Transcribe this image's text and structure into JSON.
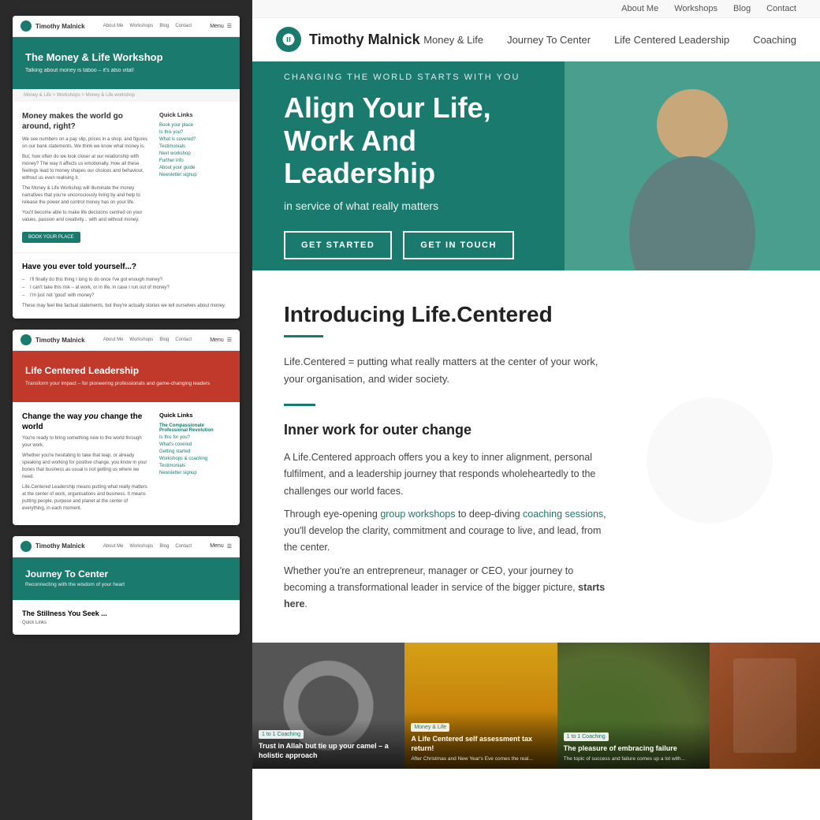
{
  "site": {
    "logo_text": "Timothy Malnick",
    "top_nav": {
      "about_me": "About Me",
      "workshops": "Workshops",
      "blog": "Blog",
      "contact": "Contact"
    },
    "main_nav": {
      "money_life": "Money & Life",
      "journey_to_center": "Journey To Center",
      "life_centered_leadership": "Life Centered Leadership",
      "coaching": "Coaching"
    },
    "hero": {
      "subtitle": "Changing the world starts with you",
      "title_line1": "Align Your Life,",
      "title_line2": "Work And Leadership",
      "tagline": "in service of what really matters",
      "btn_started": "GET STARTED",
      "btn_touch": "GET IN TOUCH"
    },
    "intro": {
      "heading": "Introducing Life.Centered",
      "body": "Life.Centered = putting what really matters at the center of your work, your organisation, and wider society.",
      "inner_work_heading": "Inner work for outer change",
      "para1": "A Life.Centered approach offers you a key to inner alignment, personal fulfilment, and a leadership journey that responds wholeheartedly to the challenges our world faces.",
      "para2_prefix": "Through eye-opening ",
      "para2_workshops": "group workshops",
      "para2_mid": " to deep-diving ",
      "para2_coaching": "coaching sessions",
      "para2_suffix": ", you'll develop the clarity, commitment and courage to live, and lead, from the center.",
      "para3_prefix": "Whether you're an entrepreneur, manager or CEO, your journey to becoming a transformational leader in service of the bigger picture, ",
      "para3_bold": "starts here",
      "para3_suffix": "."
    }
  },
  "preview_cards": {
    "card1": {
      "menu_label": "Menu",
      "logo_text": "Timothy Malnick",
      "nav_links": [
        "About Me",
        "Workshops",
        "Blog",
        "Contact"
      ],
      "hero_title": "The Money & Life Workshop",
      "hero_subtitle": "Talking about money is taboo – it's also vital!",
      "breadcrumb": "Money & Life > Workshops > Money & Life workshop",
      "main_heading": "Money makes the world go around, right?",
      "main_body_1": "We see numbers on a pay slip, prices in a shop, and figures on our bank statements. We think we know what money is.",
      "main_body_2": "But, how often do we look closer at our relationship with money? The way it affects us emotionally. How all these feelings lead to money shapes our choices and behaviour, without us even realising it.",
      "main_body_3": "The Money & Life Workshop will illuminate the money narratives that you're unconsciously living by and help to release the power and control money has on your life.",
      "main_body_4": "You'll become able to make life decisions centred on your values, passion and creativity... with and without money.",
      "book_btn": "BOOK YOUR PLACE",
      "quick_links_title": "Quick Links",
      "quick_links": [
        "Book your place",
        "Is this you?",
        "What is covered?",
        "Testimonials",
        "Next workshop",
        "Further info",
        "About your guide",
        "Newsletter signup"
      ],
      "have_you_heading": "Have you ever told yourself...?",
      "have_you_items": [
        "I'll finally do this thing I long to do once I've got enough money?",
        "I can't take this risk – at work, or in life, in case I run out of money?",
        "I'm just not 'good' with money?"
      ],
      "have_you_footer": "These may feel like factual statements, but they're actually stories we tell ourselves about money."
    },
    "card2": {
      "logo_text": "Timothy Malnick",
      "menu_label": "Menu",
      "hero_title": "Life Centered Leadership",
      "hero_subtitle": "Transform your impact – for pioneering professionals and game-changing leaders",
      "main_heading": "Change the way you change the world",
      "main_body_1": "You're ready to bring something new to the world through your work.",
      "main_body_2": "Whether you're hesitating to take that leap, or already speaking and working for positive change, you know in your bones that business as usual is not getting us where we need.",
      "main_body_3": "Life.Centered Leadership means putting what really matters at the center of work, organisations and business. It means putting people, purpose and planet at the center of everything, in each moment.",
      "quick_links_title": "Quick Links",
      "quick_links": [
        "The Compassionate Professional Revolution",
        "Is this for you?",
        "What's covered",
        "Getting started",
        "Workshops & coaching",
        "Testimonials",
        "Newsletter signup"
      ]
    },
    "card3": {
      "logo_text": "Timothy Malnick",
      "menu_label": "Menu",
      "hero_title": "Journey To Center",
      "hero_subtitle": "Reconnecting with the wisdom of your heart",
      "teaser_heading": "The Stillness You Seek ...",
      "teaser_body": "Quick Links"
    }
  },
  "blog_cards": [
    {
      "tag": "1 to 1 Coaching",
      "title": "Trust in Allah but tie up your camel – a holistic approach",
      "excerpt": ""
    },
    {
      "tag": "Money & Life",
      "title": "A Life Centered self assessment tax return!",
      "excerpt": "After Christmas and New Year's Eve comes the real..."
    },
    {
      "tag": "1 to 1 Coaching",
      "title": "The pleasure of embracing failure",
      "excerpt": "The topic of success and failure comes up a lot with..."
    }
  ]
}
